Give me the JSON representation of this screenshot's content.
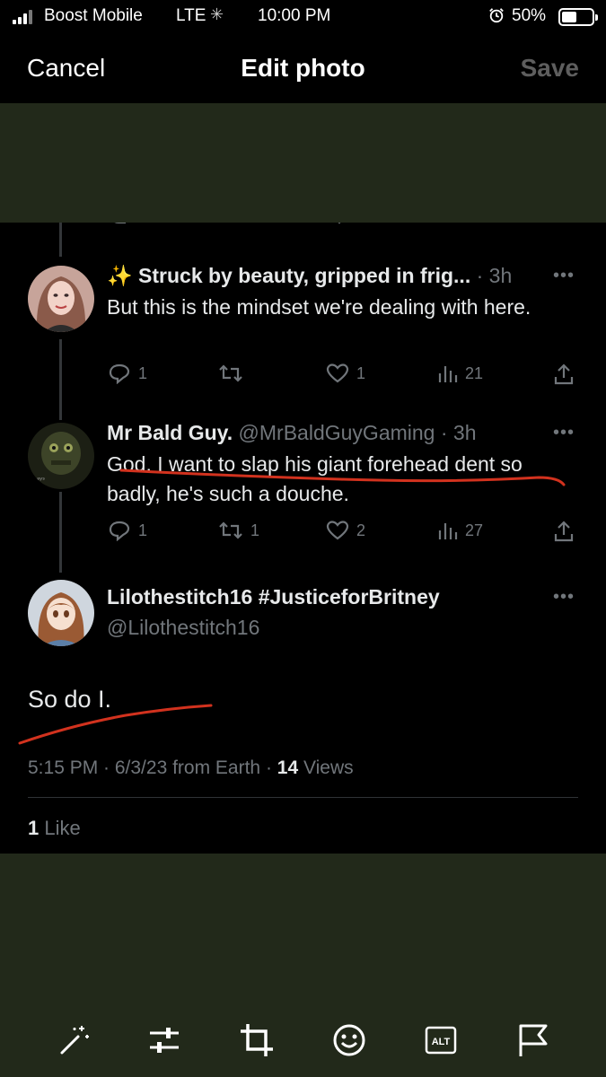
{
  "status_bar": {
    "carrier": "Boost Mobile",
    "network": "LTE",
    "time": "10:00 PM",
    "battery_pct": "50%",
    "battery_level": 0.5
  },
  "header": {
    "cancel_label": "Cancel",
    "title": "Edit photo",
    "save_label": "Save"
  },
  "replies": [
    {
      "name": "✨ Struck by beauty, gripped in frig...",
      "meta": "· 3h",
      "text": "But this is the mindset we're dealing with here.",
      "replies": "1",
      "retweets": "",
      "likes": "1",
      "views": "21"
    },
    {
      "name": "Mr Bald Guy.",
      "meta": "@MrBaldGuyGaming · 3h",
      "text": "God. I want to slap his giant forehead dent so badly, he's such a douche.",
      "replies": "1",
      "retweets": "1",
      "likes": "2",
      "views": "27"
    }
  ],
  "main_tweet": {
    "name": "Lilothestitch16 #JusticeforBritney",
    "handle": "@Lilothestitch16",
    "text": "So do I.",
    "timestamp": "5:15 PM · 6/3/23 from Earth · ",
    "views_count": "14",
    "views_label": " Views",
    "likes_count": "1",
    "likes_label": " Like"
  },
  "toolbar": {
    "icons": [
      "magic-wand-icon",
      "adjust-sliders-icon",
      "crop-icon",
      "sticker-face-icon",
      "alt-text-icon",
      "flag-icon"
    ],
    "alt_label": "ALT"
  },
  "colors": {
    "background": "#000000",
    "olive_panel": "#22291a",
    "text_primary": "#e7e9ea",
    "text_secondary": "#71767b",
    "annotation_red": "#d2321e",
    "save_disabled": "#5e5e5e"
  }
}
